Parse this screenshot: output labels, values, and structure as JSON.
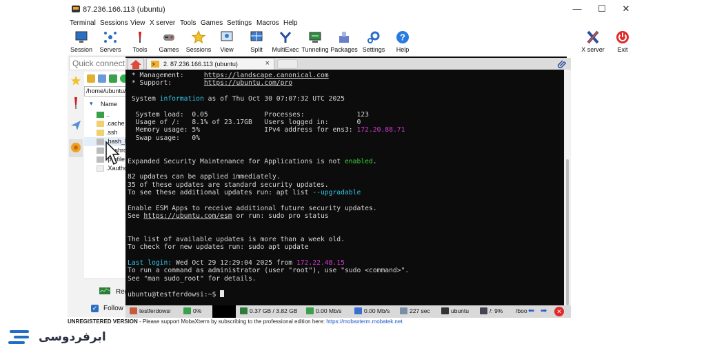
{
  "window": {
    "title": "87.236.166.113 (ubuntu)",
    "minimize": "—",
    "maximize": "☐",
    "close": "✕"
  },
  "menu": [
    "Terminal",
    "Sessions",
    "View",
    "X server",
    "Tools",
    "Games",
    "Settings",
    "Macros",
    "Help"
  ],
  "toolbar": {
    "left": [
      "Session",
      "Servers",
      "Tools",
      "Games",
      "Sessions",
      "View",
      "Split",
      "MultiExec",
      "Tunneling",
      "Packages",
      "Settings",
      "Help"
    ],
    "right": [
      "X server",
      "Exit"
    ]
  },
  "quick_connect": {
    "placeholder": "Quick connect..."
  },
  "file_browser": {
    "path": "/home/ubuntu/",
    "column": "Name",
    "files": [
      "..",
      ".cache",
      ".ssh",
      ".bash_logout",
      ".bashrc",
      ".profile",
      ".Xauthority"
    ]
  },
  "sidebar_bottom": {
    "remote_monitoring": "Remote monitoring",
    "follow_terminal": "Follow terminal folder"
  },
  "tab": {
    "label": "2. 87.236.166.113 (ubuntu)",
    "close": "×"
  },
  "terminal": {
    "mgmt_label": " * Management:     ",
    "mgmt_url": "https://landscape.canonical.com",
    "support_label": " * Support:        ",
    "support_url": "https://ubuntu.com/pro",
    "sysinfo_a": " System ",
    "sysinfo_b": "information",
    "sysinfo_c": " as of Thu Oct 30 07:07:32 UTC 2025",
    "load": "  System load:  0.05              Processes:             123",
    "usage": "  Usage of /:   8.1% of 23.17GB   Users logged in:       0",
    "mem_a": "  Memory usage: 5%                IPv4 address for ens3: ",
    "mem_ip": "172.20.88.71",
    "swap": "  Swap usage:   0%",
    "esm_a": "Expanded Security Maintenance for Applications is not ",
    "esm_b": "enabled",
    "esm_c": ".",
    "upd1": "82 updates can be applied immediately.",
    "upd2": "35 of these updates are standard security updates.",
    "upd3_a": "To see these additional updates run: apt list ",
    "upd3_b": "--upgradable",
    "esm2": "Enable ESM Apps to receive additional future security updates.",
    "esm3_a": "See ",
    "esm3_url": "https://ubuntu.com/esm",
    "esm3_b": " or run: sudo pro status",
    "list1": "The list of available updates is more than a week old.",
    "list2": "To check for new updates run: sudo apt update",
    "last_a": "Last login:",
    "last_b": " Wed Oct 29 12:29:04 2025 from ",
    "last_ip": "172.22.48.15",
    "sudo1": "To run a command as administrator (user \"root\"), use \"sudo <command>\".",
    "sudo2": "See \"man sudo_root\" for details.",
    "prompt": "ubuntu@testferdowsi:~$ "
  },
  "status_bar": {
    "host": "testferdowsi",
    "cpu": "0%",
    "mem": "0.37 GB / 3.82 GB",
    "up": "0.00 Mb/s",
    "down": "0.00 Mb/s",
    "time": "227 sec",
    "user": "ubuntu",
    "disk": "/: 9%",
    "boot": "/boo"
  },
  "unregistered": {
    "bold": "UNREGISTERED VERSION",
    "text": "  -  Please support MobaXterm by subscribing to the professional edition here: ",
    "link": "https://mobaxterm.mobatek.net"
  },
  "watermark": {
    "text": "ابرفردوسی"
  },
  "colors": {
    "accent": "#1f6fc5",
    "terminal_bg": "#0c0c0c",
    "cyan": "#33c3e6",
    "green": "#3bd43b",
    "magenta": "#d23cd2",
    "arrow": "#e02020"
  }
}
